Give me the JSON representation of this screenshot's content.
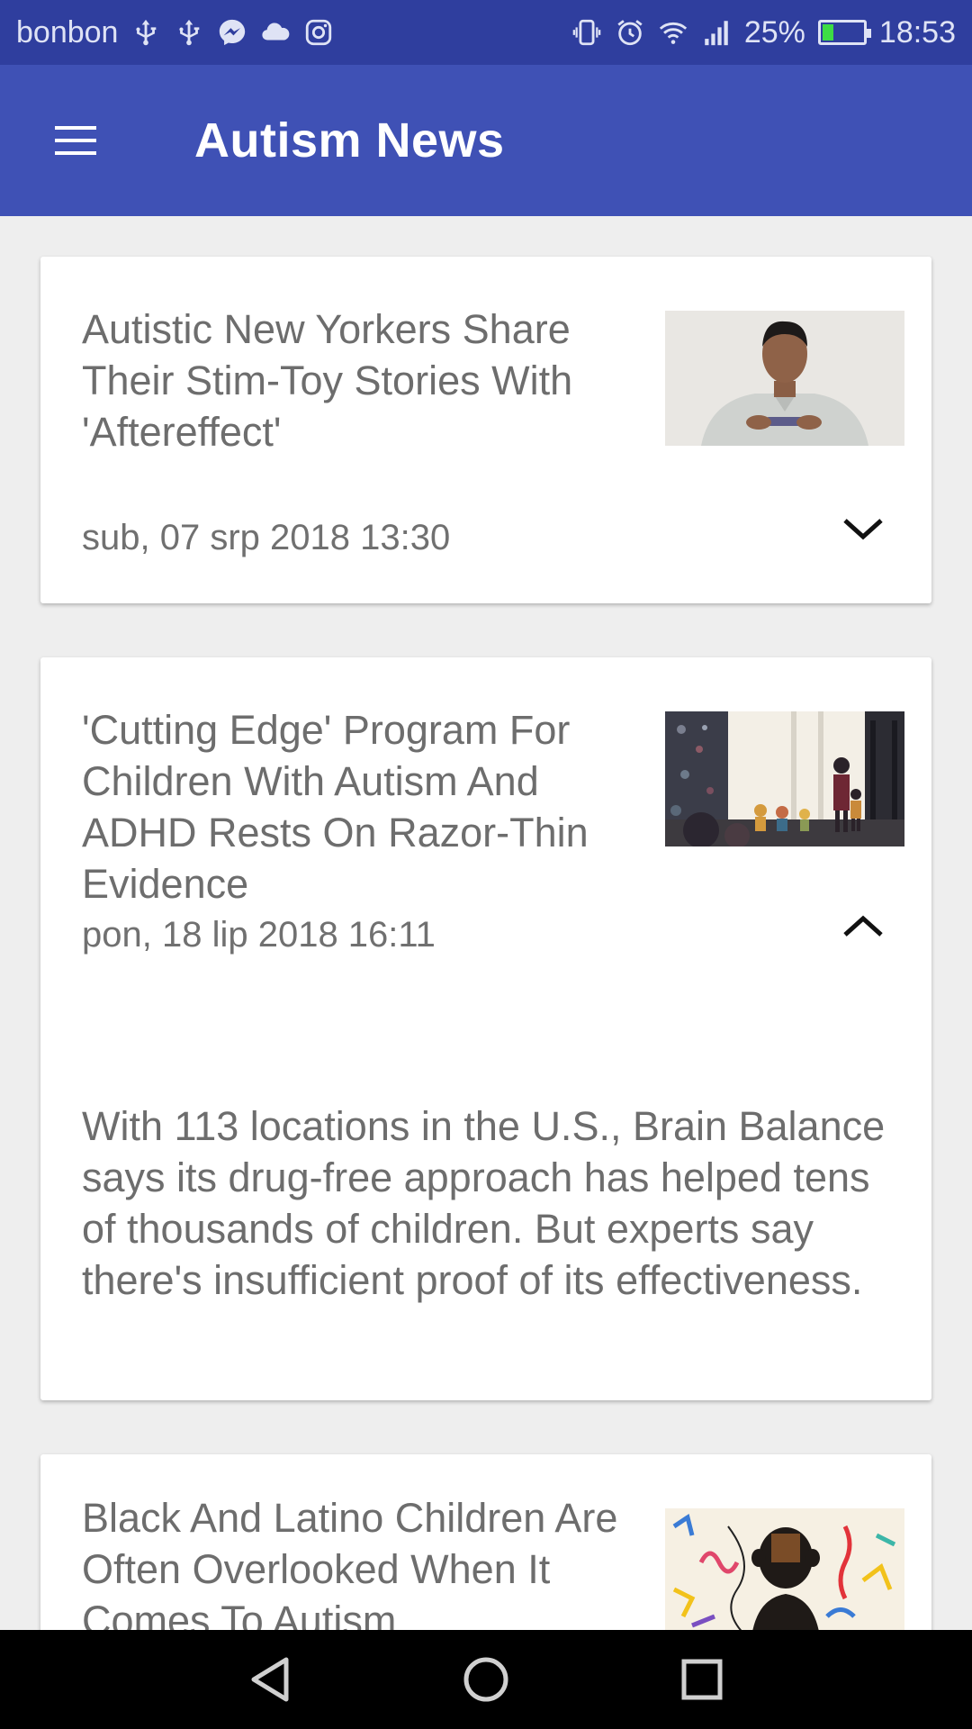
{
  "status_bar": {
    "carrier": "bonbon",
    "battery_percent": "25%",
    "time": "18:53",
    "battery_level": 0.25,
    "left_icons": [
      "usb-icon",
      "usb-icon",
      "messenger-icon",
      "cloud-icon",
      "instagram-icon"
    ],
    "right_icons": [
      "vibrate-icon",
      "alarm-icon",
      "wifi-icon",
      "signal-icon",
      "battery-icon"
    ]
  },
  "app_bar": {
    "title": "Autism News",
    "menu_icon": "hamburger-menu-icon",
    "color": "#3f51b5"
  },
  "articles": [
    {
      "title": "Autistic New Yorkers Share Their Stim-Toy Stories With 'Aftereffect'",
      "date": "sub, 07 srp 2018 13:30",
      "expanded": false,
      "toggle_icon": "chevron-down-icon",
      "description": ""
    },
    {
      "title": "'Cutting Edge' Program For Children With Autism And ADHD Rests On Razor-Thin Evidence",
      "date": "pon, 18 lip 2018 16:11",
      "expanded": true,
      "toggle_icon": "chevron-up-icon",
      "description": "With 113 locations in the U.S., Brain Balance says its drug-free approach has helped tens of thousands of children. But experts say there's insufficient proof of its effectiveness."
    },
    {
      "title": "Black And Latino Children Are Often Overlooked When It Comes To Autism",
      "date": "",
      "expanded": false,
      "toggle_icon": "chevron-down-icon",
      "description": ""
    }
  ],
  "nav_bar": {
    "back_icon": "back-triangle-icon",
    "home_icon": "home-circle-icon",
    "recents_icon": "recents-square-icon"
  }
}
